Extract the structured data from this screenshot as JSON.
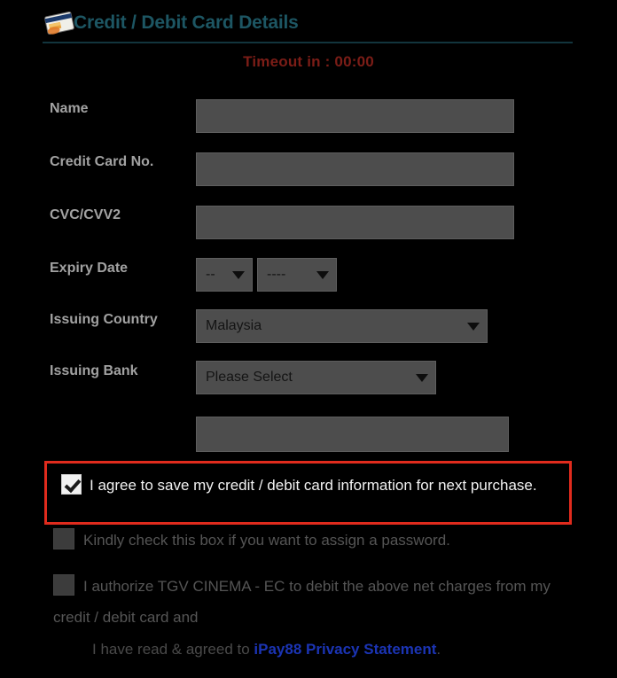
{
  "header": {
    "icon": "credit-card-icon",
    "title": "Credit / Debit Card Details",
    "timeout_text": "Timeout in : 00:00",
    "title_color": "#1d5663",
    "timeout_color": "#7c1d17"
  },
  "form": {
    "fields": [
      {
        "label": "Name",
        "value": "",
        "placeholder": ""
      },
      {
        "label": "Credit Card No.",
        "value": "",
        "placeholder": ""
      },
      {
        "label": "CVC/CVV2",
        "value": "",
        "placeholder": ""
      }
    ],
    "expiry": {
      "label": "Expiry Date",
      "month_value": "--",
      "year_value": "----"
    },
    "country": {
      "label": "Issuing Country",
      "value": "Malaysia"
    },
    "bank": {
      "label": "Issuing Bank",
      "value": "Please Select"
    },
    "extra_field": {
      "value": "",
      "placeholder": ""
    }
  },
  "consents": {
    "save_card": {
      "text": "I agree to save my credit / debit card information for next purchase.",
      "checked": true,
      "highlight_color": "#e02b1d"
    },
    "password": {
      "text": "Kindly check this box if you want to assign a password.",
      "checked": false
    },
    "authorize": {
      "text": "I authorize TGV CINEMA - EC to debit the above net charges from my credit / debit card and",
      "checked": false
    },
    "privacy": {
      "prefix": "I have read & agreed to ",
      "link_text": "iPay88 Privacy Statement",
      "suffix": ".",
      "link_color": "#1b34b4"
    }
  }
}
